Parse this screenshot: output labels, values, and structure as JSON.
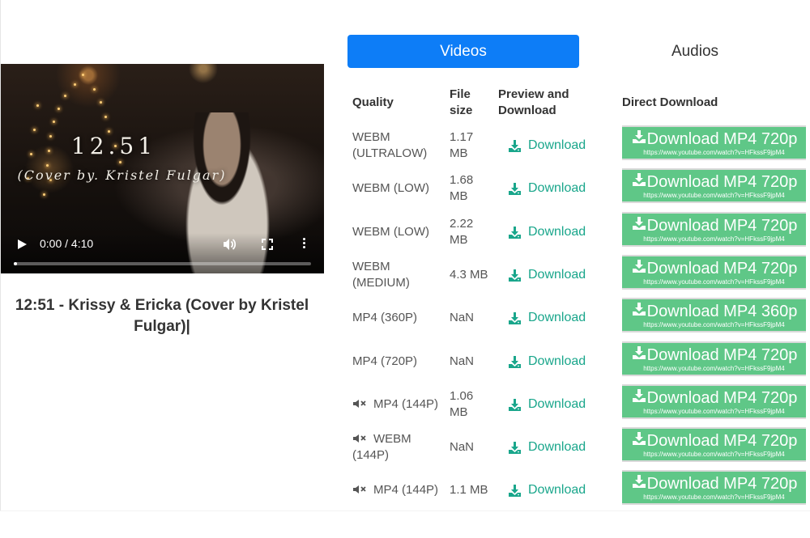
{
  "player": {
    "overlay_title": "12.51",
    "overlay_subtitle": "(Cover by. Kristel Fulgar)",
    "time": "0:00 / 4:10",
    "progress": 0.0
  },
  "video_title": "12:51 - Krissy & Ericka (Cover by Kristel Fulgar)|",
  "tabs": {
    "videos": "Videos",
    "audios": "Audios"
  },
  "table": {
    "headers": {
      "quality": "Quality",
      "file_size": "File size",
      "preview": "Preview and Download",
      "direct": "Direct Download"
    },
    "rows": [
      {
        "quality": "WEBM (ULTRALOW)",
        "size": "1.17 MB",
        "link": "Download",
        "button": "Download MP4 720p",
        "url": "https://www.youtube.com/watch?v=HFkssF9jpM4",
        "muted": false
      },
      {
        "quality": "WEBM (LOW)",
        "size": "1.68 MB",
        "link": "Download",
        "button": "Download MP4 720p",
        "url": "https://www.youtube.com/watch?v=HFkssF9jpM4",
        "muted": false
      },
      {
        "quality": "WEBM (LOW)",
        "size": "2.22 MB",
        "link": "Download",
        "button": "Download MP4 720p",
        "url": "https://www.youtube.com/watch?v=HFkssF9jpM4",
        "muted": false
      },
      {
        "quality": "WEBM (MEDIUM)",
        "size": "4.3 MB",
        "link": "Download",
        "button": "Download MP4 720p",
        "url": "https://www.youtube.com/watch?v=HFkssF9jpM4",
        "muted": false
      },
      {
        "quality": "MP4 (360P)",
        "size": "NaN",
        "link": "Download",
        "button": "Download MP4 360p",
        "url": "https://www.youtube.com/watch?v=HFkssF9jpM4",
        "muted": false
      },
      {
        "quality": "MP4 (720P)",
        "size": "NaN",
        "link": "Download",
        "button": "Download MP4 720p",
        "url": "https://www.youtube.com/watch?v=HFkssF9jpM4",
        "muted": false
      },
      {
        "quality": "MP4 (144P)",
        "size": "1.06 MB",
        "link": "Download",
        "button": "Download MP4 720p",
        "url": "https://www.youtube.com/watch?v=HFkssF9jpM4",
        "muted": true
      },
      {
        "quality": "WEBM (144P)",
        "size": "NaN",
        "link": "Download",
        "button": "Download MP4 720p",
        "url": "https://www.youtube.com/watch?v=HFkssF9jpM4",
        "muted": true
      },
      {
        "quality": "MP4 (144P)",
        "size": "1.1 MB",
        "link": "Download",
        "button": "Download MP4 720p",
        "url": "https://www.youtube.com/watch?v=HFkssF9jpM4",
        "muted": true
      }
    ]
  },
  "colors": {
    "tab_active": "#0d7df7",
    "link": "#19a68b",
    "direct_button": "#5fc787"
  },
  "icons": {
    "download": "download-icon",
    "muted": "volume-muted-icon",
    "play": "play-icon",
    "volume": "volume-icon",
    "fullscreen": "fullscreen-icon",
    "more": "more-vert-icon"
  }
}
